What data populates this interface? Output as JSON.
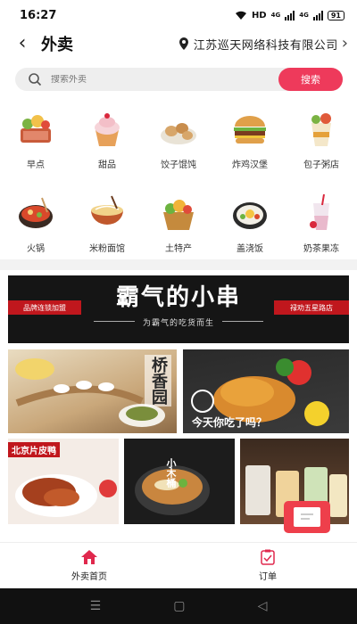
{
  "status": {
    "time": "16:27",
    "hd": "HD",
    "net1": "4G",
    "net2": "4G",
    "battery": "91"
  },
  "header": {
    "title": "外卖",
    "location": "江苏巡天网络科技有限公司"
  },
  "search": {
    "placeholder": "搜索外卖",
    "button": "搜索"
  },
  "categories": [
    {
      "label": "早点",
      "icon": "breakfast-basket-icon"
    },
    {
      "label": "甜品",
      "icon": "cupcake-icon"
    },
    {
      "label": "饺子馄饨",
      "icon": "dumpling-plate-icon"
    },
    {
      "label": "炸鸡汉堡",
      "icon": "burger-icon"
    },
    {
      "label": "包子粥店",
      "icon": "bun-porridge-icon"
    },
    {
      "label": "火锅",
      "icon": "hotpot-icon"
    },
    {
      "label": "米粉面馆",
      "icon": "noodle-bowl-icon"
    },
    {
      "label": "土特产",
      "icon": "produce-basket-icon"
    },
    {
      "label": "盖浇饭",
      "icon": "rice-pan-icon"
    },
    {
      "label": "奶茶果冻",
      "icon": "milk-tea-icon"
    }
  ],
  "banner": {
    "left_tag": "品牌连锁加盟",
    "title": "霸气的小串",
    "subtitle": "为霸气的吃货而生",
    "right_tag": "禄劝五星路店"
  },
  "tiles": {
    "bridge_noodle": {
      "caption": "桥香园"
    },
    "fried_chicken": {
      "caption": "今天你吃了吗？"
    },
    "roast_duck": {
      "caption": "北京片皮鸭"
    },
    "noodle_soup": {
      "caption": "小木桶"
    },
    "milk_tea": {
      "caption": ""
    }
  },
  "bottom_nav": {
    "home": "外卖首页",
    "orders": "订单"
  },
  "colors": {
    "accent": "#ee3a5b",
    "banner_red": "#c0171d"
  }
}
